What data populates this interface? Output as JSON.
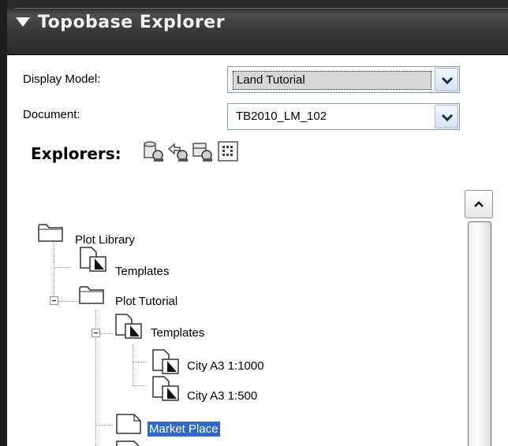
{
  "panel": {
    "title": "Topobase Explorer"
  },
  "form": {
    "display_model_label": "Display Model:",
    "display_model_value": "Land Tutorial",
    "document_label": "Document:",
    "document_value": "TB2010_LM_102"
  },
  "explorers": {
    "label": "Explorers:",
    "tools": [
      "feature-explorer-icon",
      "plot-explorer-icon",
      "job-explorer-icon",
      "topic-explorer-icon"
    ]
  },
  "tree": {
    "plot_library": "Plot Library",
    "templates": "Templates",
    "plot_tutorial": "Plot Tutorial",
    "tutorial_templates": "Templates",
    "city_a3_1000": "City A3 1:1000",
    "city_a3_500": "City A3 1:500",
    "market_place": "Market Place"
  },
  "colors": {
    "header_bg": "#3a3a3a",
    "selection": "#3169c6"
  }
}
